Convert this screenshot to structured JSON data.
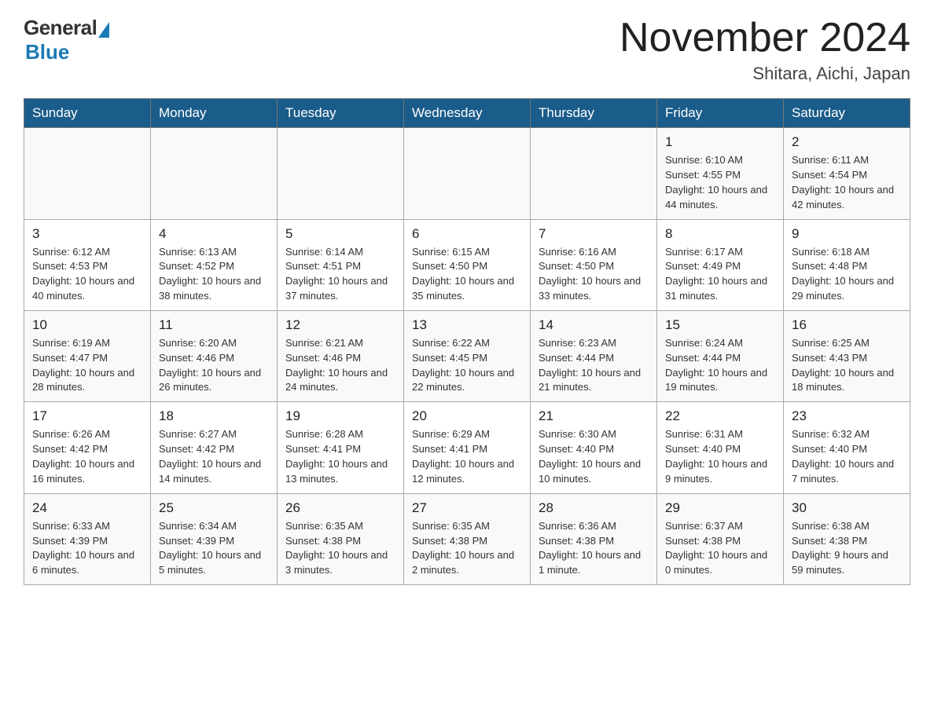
{
  "logo": {
    "general": "General",
    "blue": "Blue"
  },
  "title": "November 2024",
  "location": "Shitara, Aichi, Japan",
  "days_of_week": [
    "Sunday",
    "Monday",
    "Tuesday",
    "Wednesday",
    "Thursday",
    "Friday",
    "Saturday"
  ],
  "weeks": [
    [
      {
        "day": "",
        "info": ""
      },
      {
        "day": "",
        "info": ""
      },
      {
        "day": "",
        "info": ""
      },
      {
        "day": "",
        "info": ""
      },
      {
        "day": "",
        "info": ""
      },
      {
        "day": "1",
        "info": "Sunrise: 6:10 AM\nSunset: 4:55 PM\nDaylight: 10 hours and 44 minutes."
      },
      {
        "day": "2",
        "info": "Sunrise: 6:11 AM\nSunset: 4:54 PM\nDaylight: 10 hours and 42 minutes."
      }
    ],
    [
      {
        "day": "3",
        "info": "Sunrise: 6:12 AM\nSunset: 4:53 PM\nDaylight: 10 hours and 40 minutes."
      },
      {
        "day": "4",
        "info": "Sunrise: 6:13 AM\nSunset: 4:52 PM\nDaylight: 10 hours and 38 minutes."
      },
      {
        "day": "5",
        "info": "Sunrise: 6:14 AM\nSunset: 4:51 PM\nDaylight: 10 hours and 37 minutes."
      },
      {
        "day": "6",
        "info": "Sunrise: 6:15 AM\nSunset: 4:50 PM\nDaylight: 10 hours and 35 minutes."
      },
      {
        "day": "7",
        "info": "Sunrise: 6:16 AM\nSunset: 4:50 PM\nDaylight: 10 hours and 33 minutes."
      },
      {
        "day": "8",
        "info": "Sunrise: 6:17 AM\nSunset: 4:49 PM\nDaylight: 10 hours and 31 minutes."
      },
      {
        "day": "9",
        "info": "Sunrise: 6:18 AM\nSunset: 4:48 PM\nDaylight: 10 hours and 29 minutes."
      }
    ],
    [
      {
        "day": "10",
        "info": "Sunrise: 6:19 AM\nSunset: 4:47 PM\nDaylight: 10 hours and 28 minutes."
      },
      {
        "day": "11",
        "info": "Sunrise: 6:20 AM\nSunset: 4:46 PM\nDaylight: 10 hours and 26 minutes."
      },
      {
        "day": "12",
        "info": "Sunrise: 6:21 AM\nSunset: 4:46 PM\nDaylight: 10 hours and 24 minutes."
      },
      {
        "day": "13",
        "info": "Sunrise: 6:22 AM\nSunset: 4:45 PM\nDaylight: 10 hours and 22 minutes."
      },
      {
        "day": "14",
        "info": "Sunrise: 6:23 AM\nSunset: 4:44 PM\nDaylight: 10 hours and 21 minutes."
      },
      {
        "day": "15",
        "info": "Sunrise: 6:24 AM\nSunset: 4:44 PM\nDaylight: 10 hours and 19 minutes."
      },
      {
        "day": "16",
        "info": "Sunrise: 6:25 AM\nSunset: 4:43 PM\nDaylight: 10 hours and 18 minutes."
      }
    ],
    [
      {
        "day": "17",
        "info": "Sunrise: 6:26 AM\nSunset: 4:42 PM\nDaylight: 10 hours and 16 minutes."
      },
      {
        "day": "18",
        "info": "Sunrise: 6:27 AM\nSunset: 4:42 PM\nDaylight: 10 hours and 14 minutes."
      },
      {
        "day": "19",
        "info": "Sunrise: 6:28 AM\nSunset: 4:41 PM\nDaylight: 10 hours and 13 minutes."
      },
      {
        "day": "20",
        "info": "Sunrise: 6:29 AM\nSunset: 4:41 PM\nDaylight: 10 hours and 12 minutes."
      },
      {
        "day": "21",
        "info": "Sunrise: 6:30 AM\nSunset: 4:40 PM\nDaylight: 10 hours and 10 minutes."
      },
      {
        "day": "22",
        "info": "Sunrise: 6:31 AM\nSunset: 4:40 PM\nDaylight: 10 hours and 9 minutes."
      },
      {
        "day": "23",
        "info": "Sunrise: 6:32 AM\nSunset: 4:40 PM\nDaylight: 10 hours and 7 minutes."
      }
    ],
    [
      {
        "day": "24",
        "info": "Sunrise: 6:33 AM\nSunset: 4:39 PM\nDaylight: 10 hours and 6 minutes."
      },
      {
        "day": "25",
        "info": "Sunrise: 6:34 AM\nSunset: 4:39 PM\nDaylight: 10 hours and 5 minutes."
      },
      {
        "day": "26",
        "info": "Sunrise: 6:35 AM\nSunset: 4:38 PM\nDaylight: 10 hours and 3 minutes."
      },
      {
        "day": "27",
        "info": "Sunrise: 6:35 AM\nSunset: 4:38 PM\nDaylight: 10 hours and 2 minutes."
      },
      {
        "day": "28",
        "info": "Sunrise: 6:36 AM\nSunset: 4:38 PM\nDaylight: 10 hours and 1 minute."
      },
      {
        "day": "29",
        "info": "Sunrise: 6:37 AM\nSunset: 4:38 PM\nDaylight: 10 hours and 0 minutes."
      },
      {
        "day": "30",
        "info": "Sunrise: 6:38 AM\nSunset: 4:38 PM\nDaylight: 9 hours and 59 minutes."
      }
    ]
  ]
}
